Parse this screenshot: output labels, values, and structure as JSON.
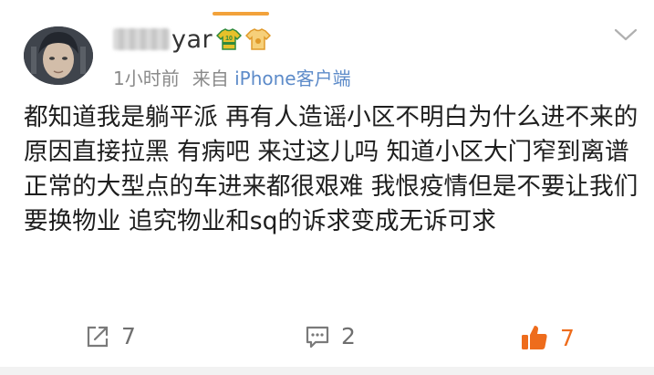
{
  "post": {
    "username_visible": "yar",
    "meta": {
      "time": "1小时前",
      "from_label": "来自",
      "source": "iPhone客户端"
    },
    "content": "都知道我是躺平派 再有人造谣小区不明白为什么进不来的原因直接拉黑 有病吧 来过这儿吗 知道小区大门窄到离谱 正常的大型点的车进来都很艰难 我恨疫情但是不要让我们要换物业 追究物业和sq的诉求变成无诉可求"
  },
  "badges": [
    {
      "icon": "football-jersey-badge-icon",
      "number": "10",
      "color": "#e6c12a"
    },
    {
      "icon": "shirt-badge-icon",
      "color": "#f0b44a"
    }
  ],
  "actions": {
    "share_count": "7",
    "comment_count": "2",
    "like_count": "7"
  },
  "colors": {
    "accent_orange": "#ee6c1c",
    "source_blue": "#5d8bc9",
    "meta_gray": "#8a8a8a"
  }
}
